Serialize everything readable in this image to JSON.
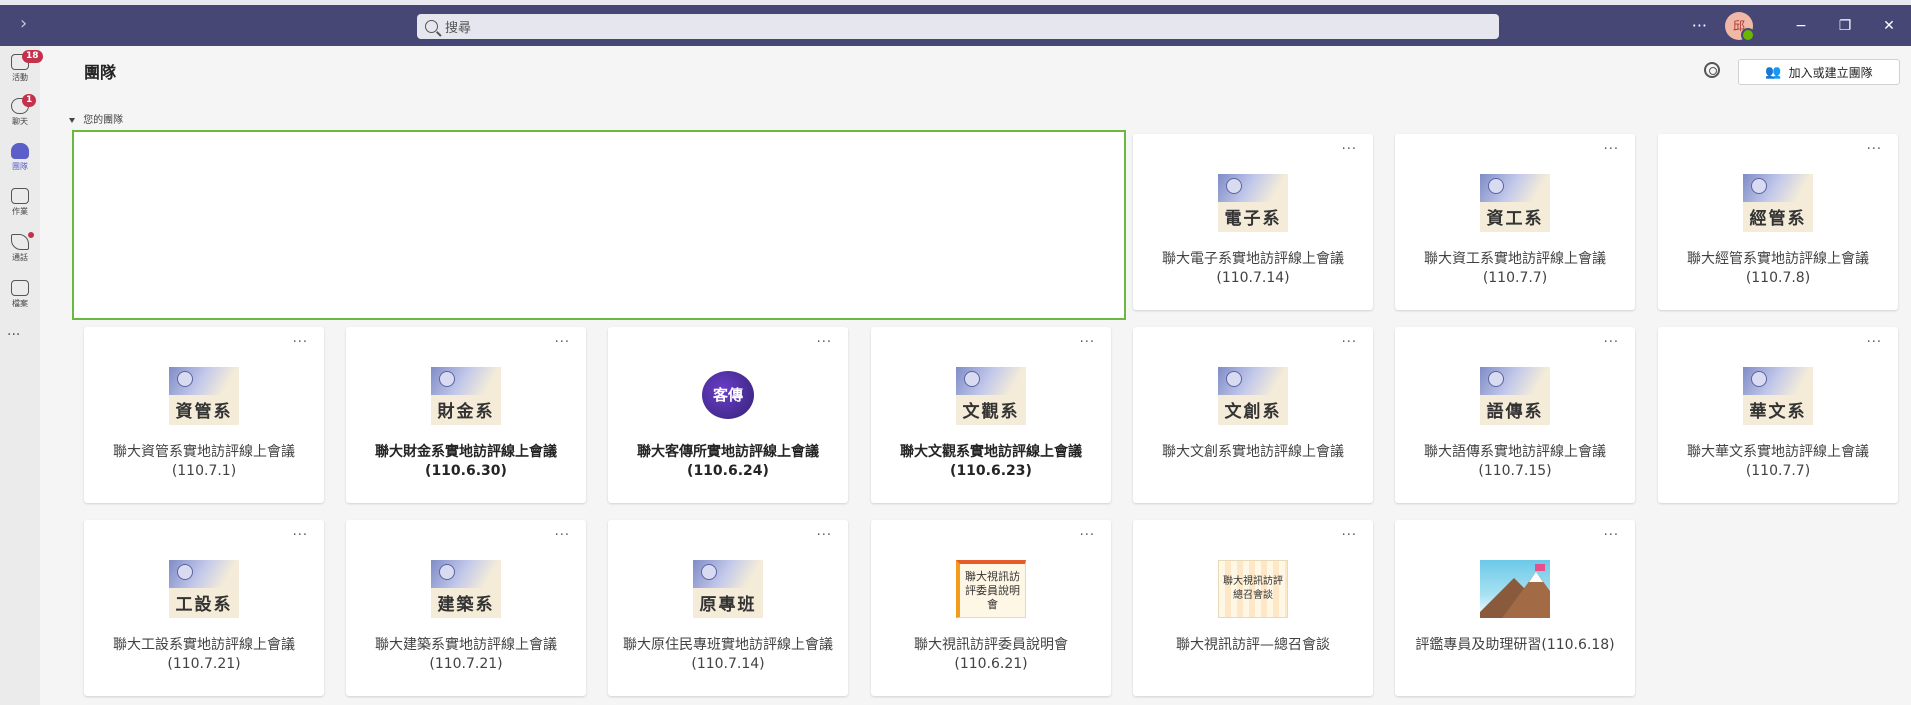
{
  "topbar": {
    "search_placeholder": "搜尋",
    "more_label": "···",
    "avatar_initial": "邱",
    "minimize": "−",
    "restore": "❐",
    "close": "✕"
  },
  "rail": [
    {
      "name": "activity",
      "label": "活動",
      "badge": "18"
    },
    {
      "name": "chat",
      "label": "聊天",
      "badge": "1"
    },
    {
      "name": "teams",
      "label": "團隊",
      "active": true
    },
    {
      "name": "assignments",
      "label": "作業"
    },
    {
      "name": "calls",
      "label": "通話",
      "dot": true
    },
    {
      "name": "files",
      "label": "檔案"
    }
  ],
  "rail_more": "···",
  "header": {
    "title": "團隊",
    "join_button": "加入或建立團隊"
  },
  "section_label": "您的團隊",
  "card_more": "···",
  "teams": [
    {
      "logo_text": "電子系",
      "name": "聯大電子系實地訪評線上會議(110.7.14)"
    },
    {
      "logo_text": "資工系",
      "name": "聯大資工系實地訪評線上會議(110.7.7)"
    },
    {
      "logo_text": "經管系",
      "name": "聯大經管系實地訪評線上會議(110.7.8)"
    },
    {
      "logo_text": "資管系",
      "name": "聯大資管系實地訪評線上會議(110.7.1)"
    },
    {
      "logo_text": "財金系",
      "name": "聯大財金系實地訪評線上會議(110.6.30)",
      "bold": true
    },
    {
      "logo_text": "客傳",
      "name": "聯大客傳所實地訪評線上會議(110.6.24)",
      "bold": true
    },
    {
      "logo_text": "文觀系",
      "name": "聯大文觀系實地訪評線上會議(110.6.23)",
      "bold": true
    },
    {
      "logo_text": "文創系",
      "name": "聯大文創系實地訪評線上會議"
    },
    {
      "logo_text": "語傳系",
      "name": "聯大語傳系實地訪評線上會議(110.7.15)"
    },
    {
      "logo_text": "華文系",
      "name": "聯大華文系實地訪評線上會議(110.7.7)"
    },
    {
      "logo_text": "工設系",
      "name": "聯大工設系實地訪評線上會議(110.7.21)"
    },
    {
      "logo_text": "建築系",
      "name": "聯大建築系實地訪評線上會議(110.7.21)"
    },
    {
      "logo_text": "原專班",
      "name": "聯大原住民專班實地訪評線上會議(110.7.14)"
    },
    {
      "logo_text": "聯大視訊訪評委員說明會",
      "name": "聯大視訊訪評委員說明會(110.6.21)"
    },
    {
      "logo_text": "聯大視訊訪評總召會談",
      "name": "聯大視訊訪評—總召會談"
    },
    {
      "logo_text": "",
      "name": "評鑑專員及助理研習(110.6.18)"
    }
  ]
}
